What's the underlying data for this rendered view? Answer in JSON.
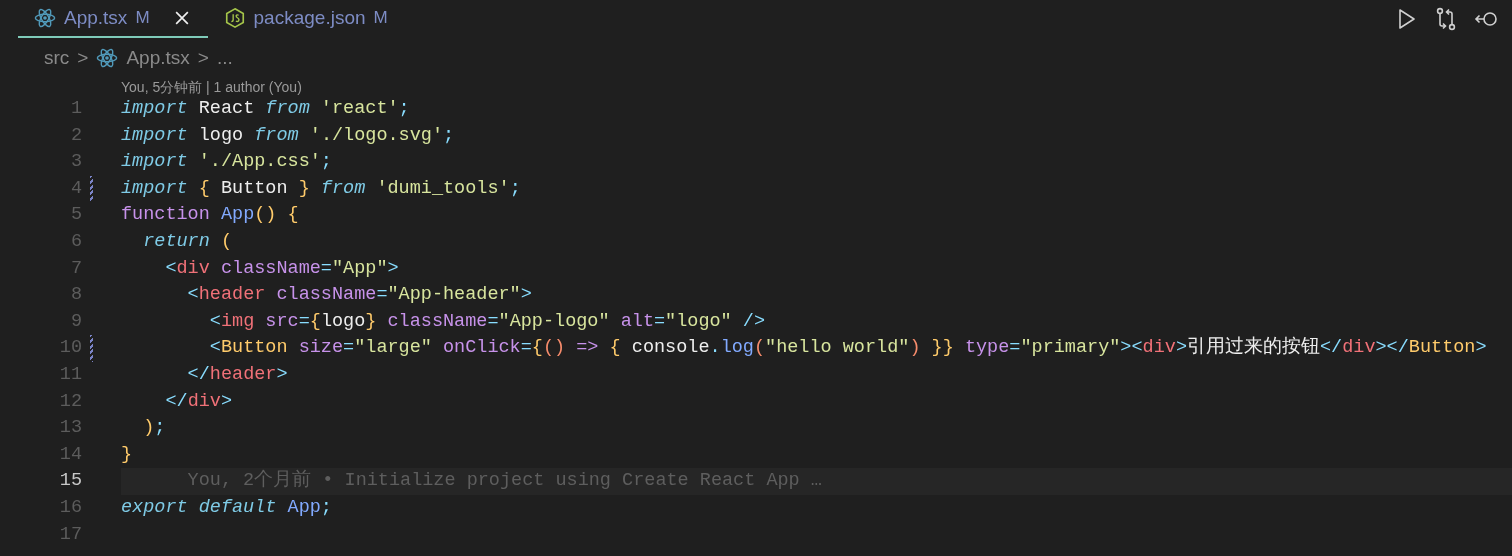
{
  "tabs": [
    {
      "label": "App.tsx",
      "status": "M",
      "selected": true,
      "closable": true
    },
    {
      "label": "package.json",
      "status": "M",
      "selected": false,
      "closable": false
    }
  ],
  "breadcrumbs": [
    {
      "kind": "text",
      "text": "src"
    },
    {
      "kind": "sep",
      "text": ">"
    },
    {
      "kind": "file",
      "text": "App.tsx"
    },
    {
      "kind": "sep",
      "text": ">"
    },
    {
      "kind": "text",
      "text": "..."
    }
  ],
  "codelens": "You, 5分钟前 | 1 author (You)",
  "lines": [
    {
      "number": "1",
      "modified": false,
      "current": false,
      "tokens": [
        {
          "kind": "kw",
          "text": "import"
        },
        {
          "kind": "plain",
          "text": " React "
        },
        {
          "kind": "kw",
          "text": "from"
        },
        {
          "kind": "str",
          "text": " 'react'"
        },
        {
          "kind": "punct",
          "text": ";"
        }
      ]
    },
    {
      "number": "2",
      "modified": false,
      "current": false,
      "tokens": [
        {
          "kind": "kw",
          "text": "import"
        },
        {
          "kind": "plain",
          "text": " logo "
        },
        {
          "kind": "kw",
          "text": "from"
        },
        {
          "kind": "str",
          "text": " './logo.svg'"
        },
        {
          "kind": "punct",
          "text": ";"
        }
      ]
    },
    {
      "number": "3",
      "modified": false,
      "current": false,
      "tokens": [
        {
          "kind": "kw",
          "text": "import"
        },
        {
          "kind": "str",
          "text": " './App.css'"
        },
        {
          "kind": "punct",
          "text": ";"
        }
      ]
    },
    {
      "number": "4",
      "modified": true,
      "current": false,
      "tokens": [
        {
          "kind": "kw",
          "text": "import"
        },
        {
          "kind": "brace",
          "text": " {"
        },
        {
          "kind": "plain",
          "text": " Button "
        },
        {
          "kind": "brace",
          "text": "}"
        },
        {
          "kind": "kw",
          "text": " from"
        },
        {
          "kind": "str",
          "text": " 'dumi_tools'"
        },
        {
          "kind": "punct",
          "text": ";"
        }
      ]
    },
    {
      "number": "5",
      "modified": false,
      "current": false,
      "tokens": [
        {
          "kind": "storage",
          "text": "function"
        },
        {
          "kind": "fn",
          "text": " App"
        },
        {
          "kind": "brace",
          "text": "() {"
        }
      ]
    },
    {
      "number": "6",
      "modified": false,
      "current": false,
      "tokens": [
        {
          "kind": "kw",
          "text": "  return"
        },
        {
          "kind": "brace",
          "text": " ("
        }
      ]
    },
    {
      "number": "7",
      "modified": false,
      "current": false,
      "tokens": [
        {
          "kind": "punct",
          "text": "    <"
        },
        {
          "kind": "tag",
          "text": "div"
        },
        {
          "kind": "attr",
          "text": " className"
        },
        {
          "kind": "punct",
          "text": "="
        },
        {
          "kind": "str",
          "text": "\"App\""
        },
        {
          "kind": "punct",
          "text": ">"
        }
      ]
    },
    {
      "number": "8",
      "modified": false,
      "current": false,
      "tokens": [
        {
          "kind": "punct",
          "text": "      <"
        },
        {
          "kind": "tag",
          "text": "header"
        },
        {
          "kind": "attr",
          "text": " className"
        },
        {
          "kind": "punct",
          "text": "="
        },
        {
          "kind": "str",
          "text": "\"App-header\""
        },
        {
          "kind": "punct",
          "text": ">"
        }
      ]
    },
    {
      "number": "9",
      "modified": false,
      "current": false,
      "tokens": [
        {
          "kind": "punct",
          "text": "        <"
        },
        {
          "kind": "tag",
          "text": "img"
        },
        {
          "kind": "attr",
          "text": " src"
        },
        {
          "kind": "punct",
          "text": "="
        },
        {
          "kind": "brace",
          "text": "{"
        },
        {
          "kind": "plain",
          "text": "logo"
        },
        {
          "kind": "brace",
          "text": "}"
        },
        {
          "kind": "attr",
          "text": " className"
        },
        {
          "kind": "punct",
          "text": "="
        },
        {
          "kind": "str",
          "text": "\"App-logo\""
        },
        {
          "kind": "attr",
          "text": " alt"
        },
        {
          "kind": "punct",
          "text": "="
        },
        {
          "kind": "str",
          "text": "\"logo\""
        },
        {
          "kind": "punct",
          "text": " />"
        }
      ]
    },
    {
      "number": "10",
      "modified": true,
      "current": false,
      "tokens": [
        {
          "kind": "punct",
          "text": "        <"
        },
        {
          "kind": "comp",
          "text": "Button"
        },
        {
          "kind": "attr",
          "text": " size"
        },
        {
          "kind": "punct",
          "text": "="
        },
        {
          "kind": "str",
          "text": "\"large\""
        },
        {
          "kind": "attr",
          "text": " onClick"
        },
        {
          "kind": "punct",
          "text": "="
        },
        {
          "kind": "brace",
          "text": "{"
        },
        {
          "kind": "paren",
          "text": "()"
        },
        {
          "kind": "storage",
          "text": " =>"
        },
        {
          "kind": "brace",
          "text": " {"
        },
        {
          "kind": "plain",
          "text": " console"
        },
        {
          "kind": "punct",
          "text": "."
        },
        {
          "kind": "fn",
          "text": "log"
        },
        {
          "kind": "paren",
          "text": "("
        },
        {
          "kind": "str",
          "text": "\"hello world\""
        },
        {
          "kind": "paren",
          "text": ")"
        },
        {
          "kind": "brace",
          "text": " }}"
        },
        {
          "kind": "attr",
          "text": " type"
        },
        {
          "kind": "punct",
          "text": "="
        },
        {
          "kind": "str",
          "text": "\"primary\""
        },
        {
          "kind": "punct",
          "text": "><"
        },
        {
          "kind": "tag",
          "text": "div"
        },
        {
          "kind": "punct",
          "text": ">"
        },
        {
          "kind": "plain",
          "text": "引用过来的按钮"
        },
        {
          "kind": "punct",
          "text": "</"
        },
        {
          "kind": "tag",
          "text": "div"
        },
        {
          "kind": "punct",
          "text": "></"
        },
        {
          "kind": "comp",
          "text": "Button"
        },
        {
          "kind": "punct",
          "text": ">"
        }
      ]
    },
    {
      "number": "11",
      "modified": false,
      "current": false,
      "tokens": [
        {
          "kind": "punct",
          "text": "      </"
        },
        {
          "kind": "tag",
          "text": "header"
        },
        {
          "kind": "punct",
          "text": ">"
        }
      ]
    },
    {
      "number": "12",
      "modified": false,
      "current": false,
      "tokens": [
        {
          "kind": "punct",
          "text": "    </"
        },
        {
          "kind": "tag",
          "text": "div"
        },
        {
          "kind": "punct",
          "text": ">"
        }
      ]
    },
    {
      "number": "13",
      "modified": false,
      "current": false,
      "tokens": [
        {
          "kind": "brace",
          "text": "  )"
        },
        {
          "kind": "punct",
          "text": ";"
        }
      ]
    },
    {
      "number": "14",
      "modified": false,
      "current": false,
      "tokens": [
        {
          "kind": "brace",
          "text": "}"
        }
      ]
    },
    {
      "number": "15",
      "modified": false,
      "current": true,
      "blame": "You, 2个月前 • Initialize project using Create React App …"
    },
    {
      "number": "16",
      "modified": false,
      "current": false,
      "tokens": [
        {
          "kind": "kw",
          "text": "export default"
        },
        {
          "kind": "fn",
          "text": " App"
        },
        {
          "kind": "punct",
          "text": ";"
        }
      ]
    },
    {
      "number": "17",
      "modified": false,
      "current": false
    }
  ],
  "toolbar": [
    {
      "kind": "run"
    },
    {
      "kind": "compare"
    },
    {
      "kind": "revert"
    }
  ]
}
